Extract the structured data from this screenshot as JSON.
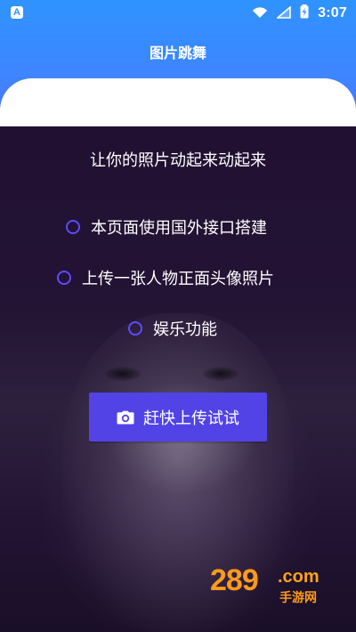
{
  "status_bar": {
    "left_badge": "A",
    "time": "3:07"
  },
  "header": {
    "title": "图片跳舞"
  },
  "main": {
    "headline": "让你的照片动起来动起来",
    "features": [
      {
        "text": "本页面使用国外接口搭建"
      },
      {
        "text": "上传一张人物正面头像照片"
      },
      {
        "text": "娱乐功能"
      }
    ],
    "cta_label": "赶快上传试试"
  },
  "watermark": {
    "number": "289",
    "domain": ".com",
    "sub": "手游网"
  },
  "colors": {
    "header_gradient_top": "#2f93ff",
    "header_gradient_bottom": "#4f6cff",
    "accent": "#5143e6",
    "bullet_ring": "#5b4cff"
  },
  "icons": {
    "status_wifi": "wifi-icon",
    "status_signal": "cell-signal-icon",
    "status_battery": "battery-charging-icon",
    "cta_icon": "camera-icon"
  }
}
